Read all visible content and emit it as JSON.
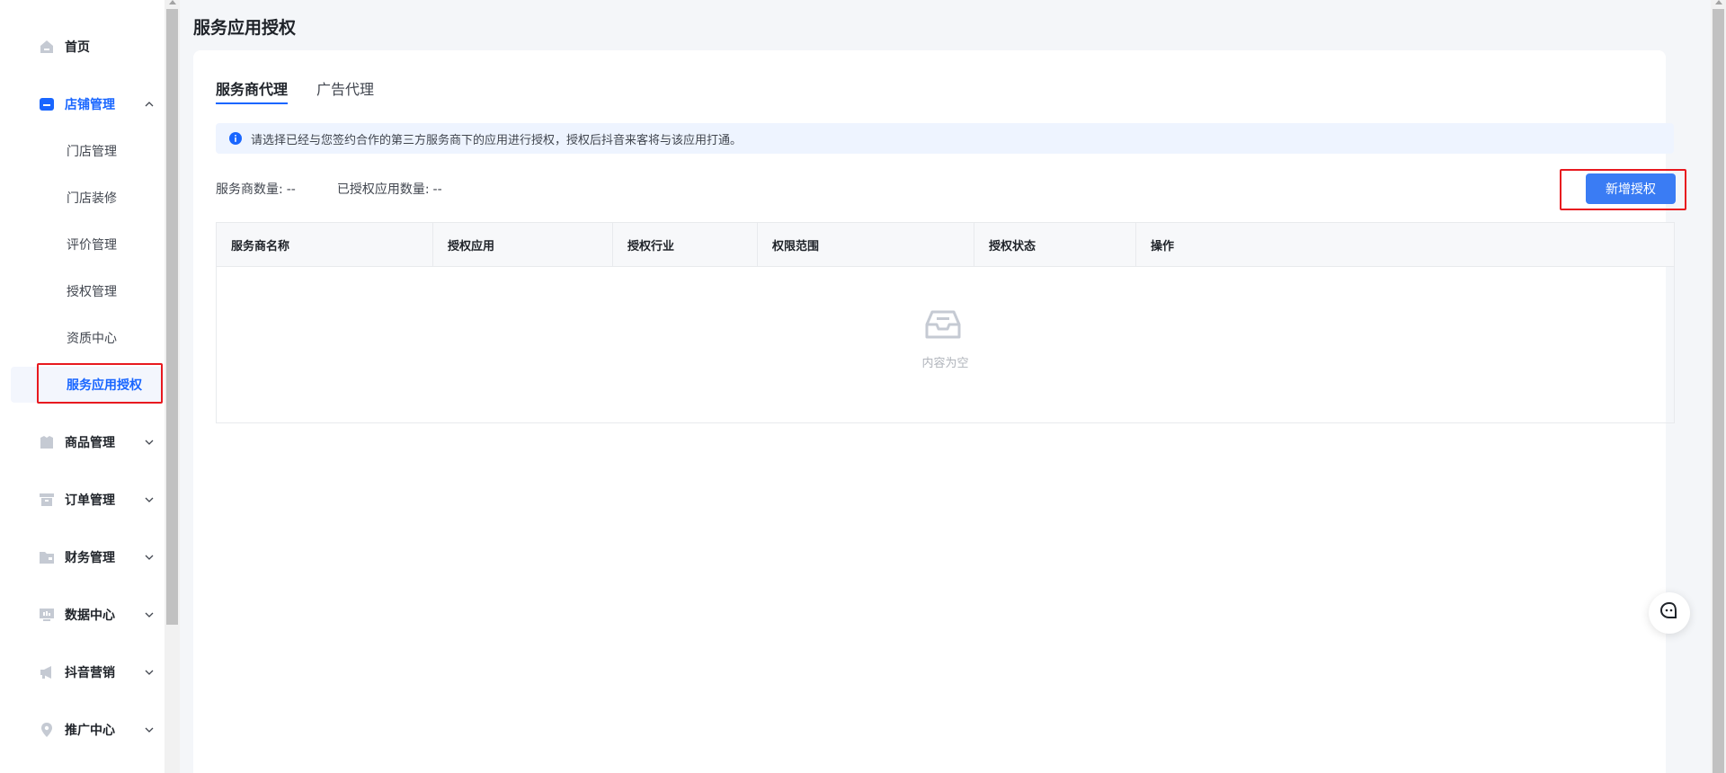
{
  "sidebar": {
    "items": [
      {
        "label": "首页",
        "icon": "home-icon"
      },
      {
        "label": "店铺管理",
        "icon": "store-icon",
        "expanded": true,
        "children": [
          "门店管理",
          "门店装修",
          "评价管理",
          "授权管理",
          "资质中心",
          "服务应用授权"
        ]
      },
      {
        "label": "商品管理",
        "icon": "goods-icon"
      },
      {
        "label": "订单管理",
        "icon": "order-icon"
      },
      {
        "label": "财务管理",
        "icon": "finance-icon"
      },
      {
        "label": "数据中心",
        "icon": "data-icon"
      },
      {
        "label": "抖音营销",
        "icon": "megaphone-icon"
      },
      {
        "label": "推广中心",
        "icon": "location-icon"
      }
    ],
    "selected": "服务应用授权"
  },
  "page": {
    "title": "服务应用授权"
  },
  "tabs": [
    "服务商代理",
    "广告代理"
  ],
  "active_tab": "服务商代理",
  "alert": {
    "text": "请选择已经与您签约合作的第三方服务商下的应用进行授权，授权后抖音来客将与该应用打通。"
  },
  "stats": {
    "provider_label": "服务商数量:",
    "provider_value": "--",
    "authorized_label": "已授权应用数量:",
    "authorized_value": "--"
  },
  "actions": {
    "add_label": "新增授权"
  },
  "table": {
    "columns": [
      "服务商名称",
      "授权应用",
      "授权行业",
      "权限范围",
      "授权状态",
      "操作"
    ],
    "rows": [],
    "empty_text": "内容为空"
  },
  "colors": {
    "accent": "#1966ff",
    "button": "#3a7cf4",
    "highlight": "#e8191f"
  }
}
